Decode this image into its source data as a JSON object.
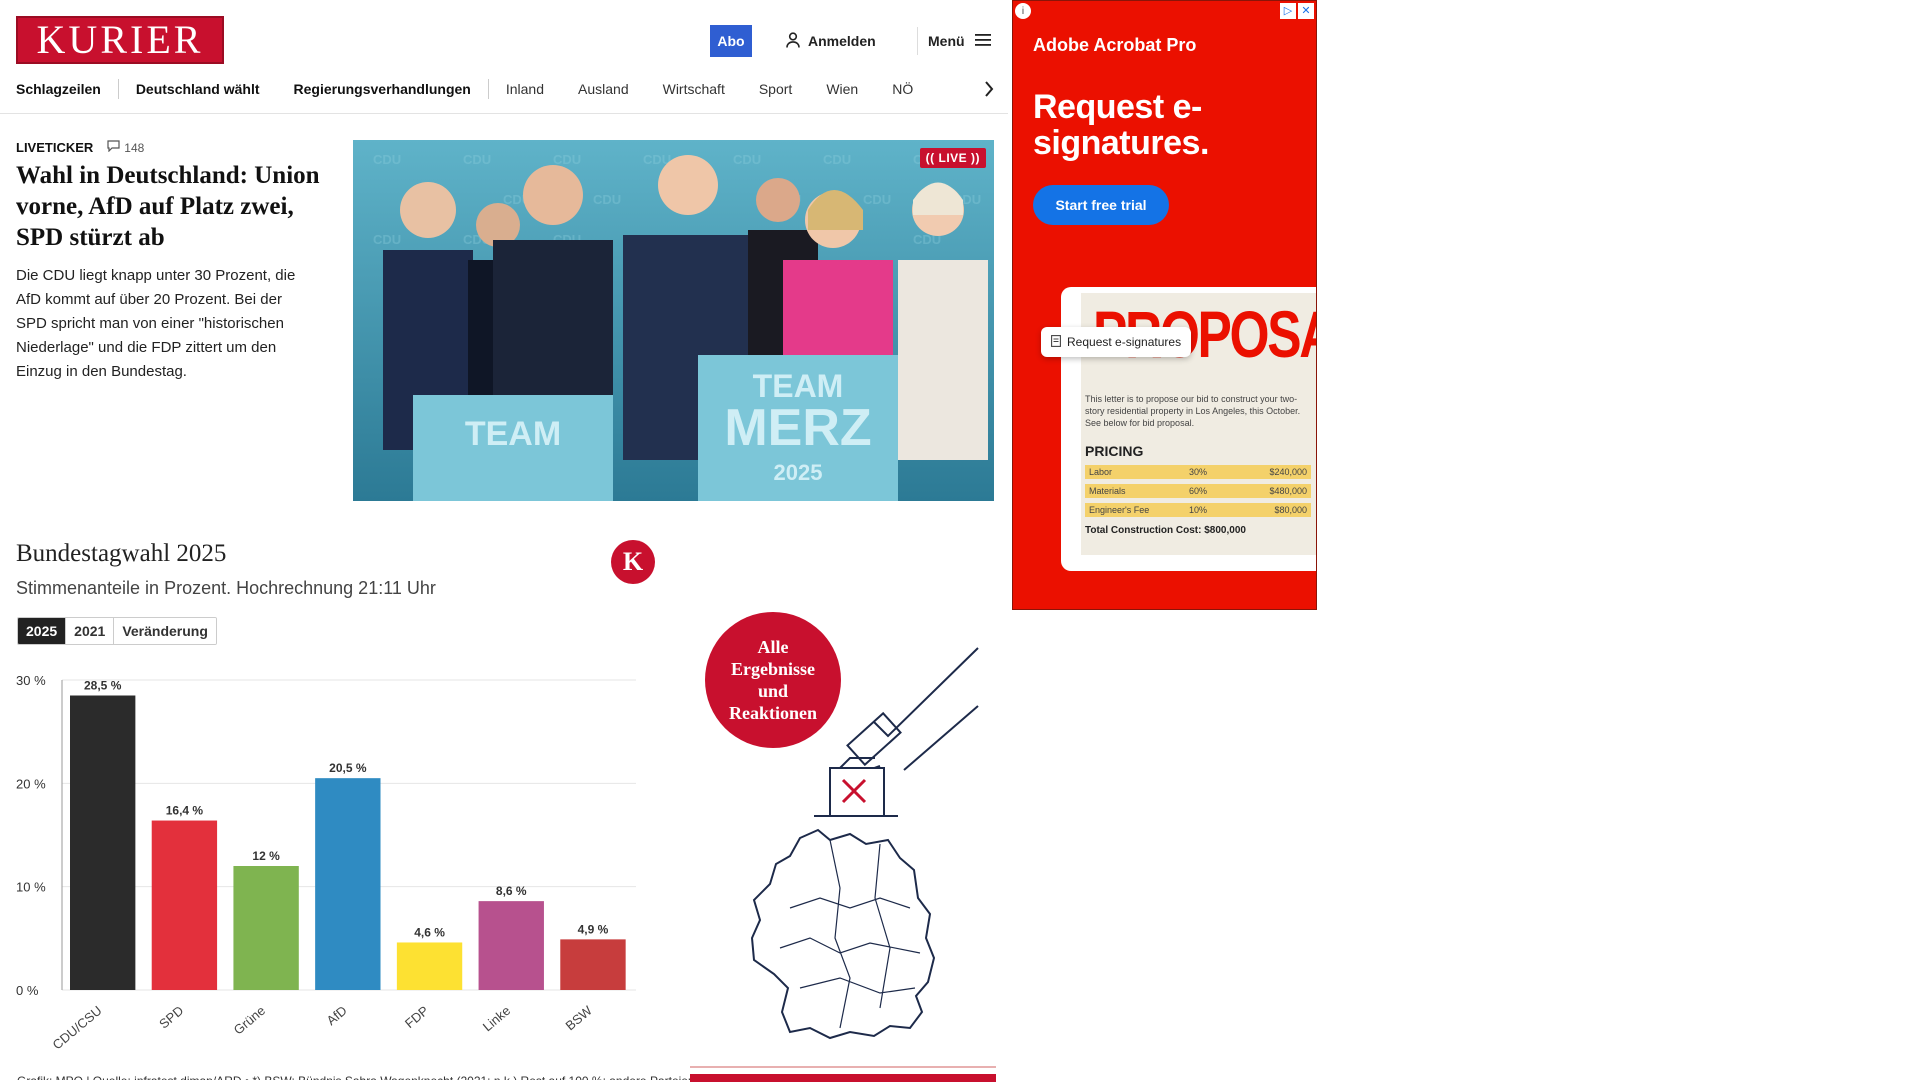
{
  "header": {
    "logo": "KURIER",
    "abo_label": "Abo",
    "login_label": "Anmelden",
    "menu_label": "Menü"
  },
  "nav": {
    "items": [
      "Schlagzeilen",
      "Deutschland wählt",
      "Regierungsverhandlungen",
      "Inland",
      "Ausland",
      "Wirtschaft",
      "Sport",
      "Wien",
      "NÖ"
    ]
  },
  "article": {
    "kicker": "LIVETICKER",
    "comment_count": "148",
    "headline": "Wahl in Deutschland: Union vorne, AfD auf Platz zwei, SPD stürzt ab",
    "teaser": "Die CDU liegt knapp unter 30 Prozent, die AfD kommt auf über 20 Prozent. Bei der SPD spricht man von einer \"historischen Niederlage\" und die FDP zittert um den Einzug in den Bundestag.",
    "live_badge": "(( LIVE ))",
    "photo_signs": [
      "TEAM",
      "MERZ",
      "2025"
    ]
  },
  "chart_section": {
    "logo_letter": "K",
    "tabs": [
      {
        "label": "2025",
        "active": true
      },
      {
        "label": "2021",
        "active": false
      },
      {
        "label": "Veränderung",
        "active": false
      }
    ],
    "source": "Grafik: MPO | Quelle: infratest dimap/ARD • *) BSW: Bündnis Sahra Wagenknecht (2021: n.k.) Rest auf 100 %: andere Parteien"
  },
  "chart_data": {
    "type": "bar",
    "title": "Bundestagwahl 2025",
    "subtitle": "Stimmenanteile in Prozent. Hochrechnung 21:11 Uhr",
    "categories": [
      "CDU/CSU",
      "SPD",
      "Grüne",
      "AfD",
      "FDP",
      "Linke",
      "BSW"
    ],
    "values": [
      28.5,
      16.4,
      12,
      20.5,
      4.6,
      8.6,
      4.9
    ],
    "value_labels": [
      "28,5 %",
      "16,4 %",
      "12 %",
      "20,5 %",
      "4,6 %",
      "8,6 %",
      "4,9 %"
    ],
    "colors": [
      "#2b2b2b",
      "#e3303c",
      "#7fb450",
      "#2f8bc2",
      "#fde132",
      "#b7518e",
      "#c73d3d"
    ],
    "ylim": [
      0,
      30
    ],
    "yticks": [
      0,
      10,
      20,
      30
    ],
    "ytick_labels": [
      "0 %",
      "10 %",
      "20 %",
      "30 %"
    ],
    "grid": true
  },
  "results_promo": {
    "label": "Alle Ergebnisse und Reaktionen"
  },
  "ad": {
    "brand": "Adobe Acrobat Pro",
    "headline": "Request e-signatures.",
    "cta": "Start free trial",
    "chip": "Request e-signatures",
    "doc_title": "PROPOSAL",
    "doc_body": "This letter is to propose our bid to construct your two-story residential property in Los Angeles, this October. See below for bid proposal.",
    "pricing_title": "PRICING",
    "pricing_rows": [
      {
        "item": "Labor",
        "pct": "30%",
        "amount": "$240,000"
      },
      {
        "item": "Materials",
        "pct": "60%",
        "amount": "$480,000"
      },
      {
        "item": "Engineer's Fee",
        "pct": "10%",
        "amount": "$80,000"
      }
    ],
    "total": "Total Construction Cost: $800,000"
  },
  "colors": {
    "brand_red": "#c8102e",
    "abo_blue": "#2f5ed2",
    "ad_red": "#eb1000",
    "ad_cta_blue": "#1473e6"
  }
}
